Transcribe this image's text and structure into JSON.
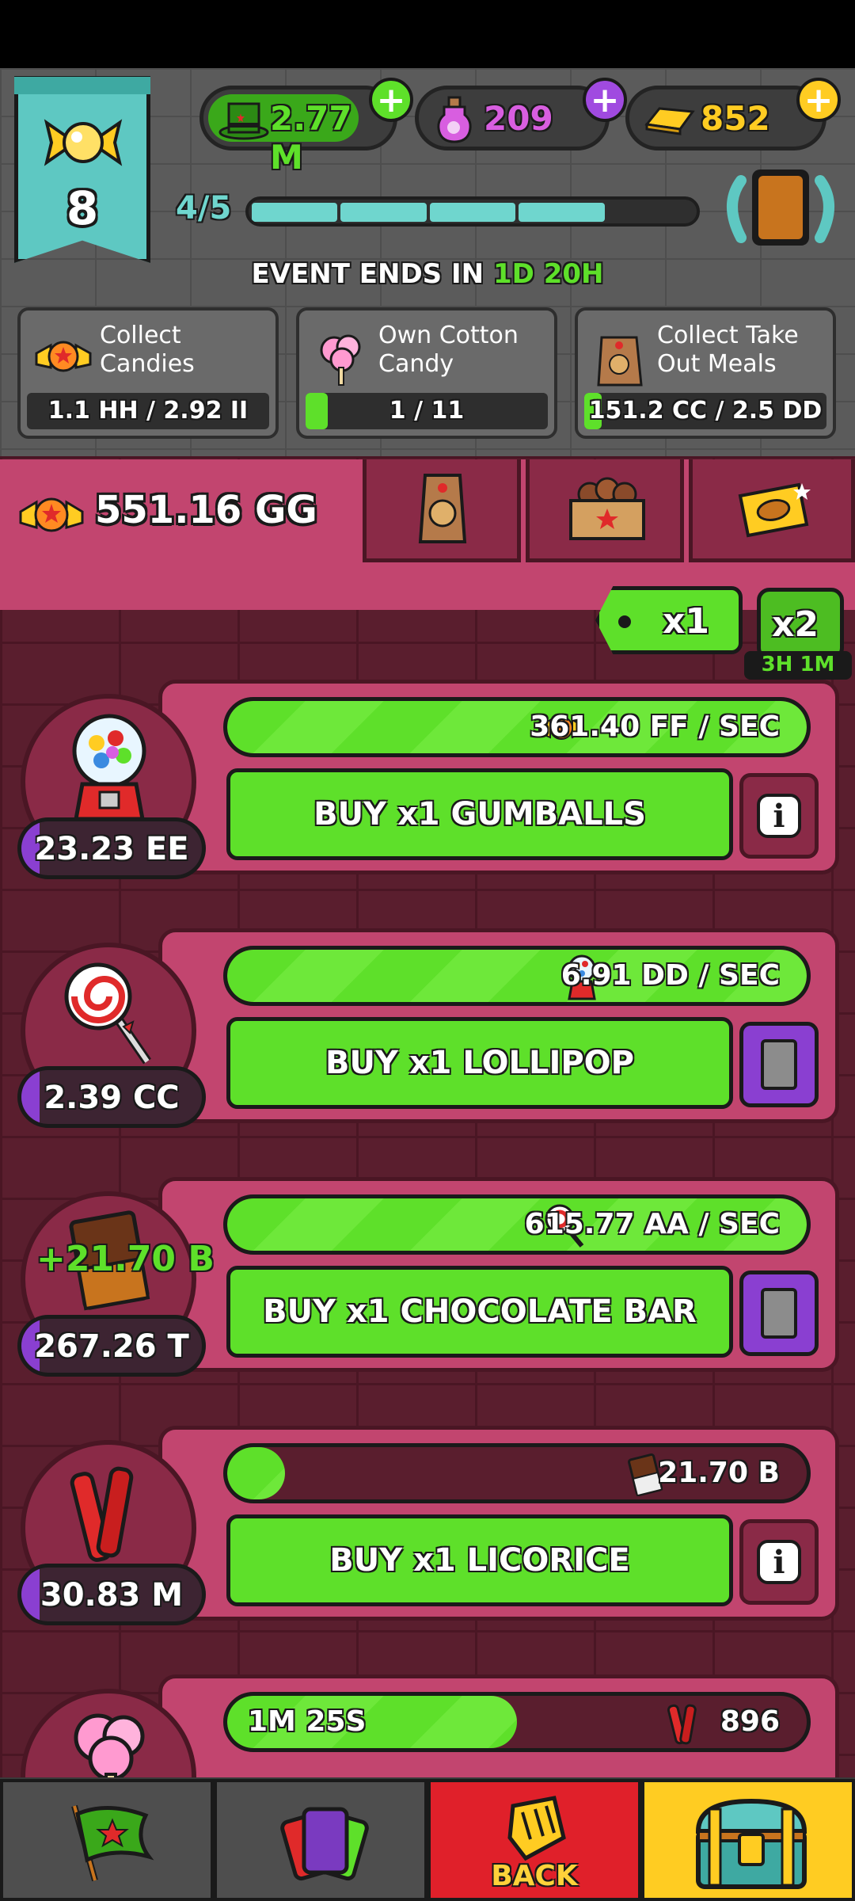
{
  "header": {
    "level": "8",
    "currency_cash": "2.77 M",
    "currency_potion": "209",
    "currency_gold": "852",
    "level_progress_text": "4/5",
    "level_progress_fraction": 0.8
  },
  "event": {
    "title_prefix": "EVENT ENDS IN ",
    "days": "1D",
    "hours": "20H",
    "tasks": [
      {
        "label": "Collect Candies",
        "progress": "1.1 HH / 2.92 II",
        "fraction": 0.0
      },
      {
        "label": "Own Cotton Candy",
        "progress": "1 / 11",
        "fraction": 0.09
      },
      {
        "label": "Collect Take Out Meals",
        "progress": "151.2 CC / 2.5 DD",
        "fraction": 0.06
      }
    ]
  },
  "candy": {
    "total": "551.16 GG",
    "multiplier_selected": "x1",
    "multiplier_boost": "x2",
    "boost_timer": "3H 1M"
  },
  "producers": [
    {
      "name": "gumballs",
      "cost": "23.23 EE",
      "cost_fraction": 0.1,
      "rate": "361.40 FF / SEC",
      "rate_fraction": 1.0,
      "buy_label": "BUY x1 GUMBALLS",
      "side": "info"
    },
    {
      "name": "lollipop",
      "cost": "2.39 CC",
      "cost_fraction": 0.1,
      "rate": "6.91 DD / SEC",
      "rate_fraction": 1.0,
      "buy_label": "BUY x1 LOLLIPOP",
      "side": "card"
    },
    {
      "name": "chocolate-bar",
      "cost": "267.26 T",
      "cost_fraction": 0.1,
      "rate": "615.77 AA / SEC",
      "rate_fraction": 1.0,
      "buy_label": "BUY x1 CHOCOLATE BAR",
      "side": "card",
      "float": "+21.70 B"
    },
    {
      "name": "licorice",
      "cost": "30.83 M",
      "cost_fraction": 0.1,
      "rate": "21.70 B",
      "rate_fraction": 0.1,
      "buy_label": "BUY x1 LICORICE",
      "side": "info"
    },
    {
      "name": "cotton-candy",
      "rate": "896",
      "rate_fraction": 0.5,
      "timer": "1M 25S"
    }
  ],
  "nav": {
    "back_label": "BACK"
  },
  "colors": {
    "green": "#5ee02a",
    "pink": "#c2456f",
    "maroon": "#5a1e2e",
    "purple": "#8a3fd1",
    "teal": "#5ec8c2"
  }
}
